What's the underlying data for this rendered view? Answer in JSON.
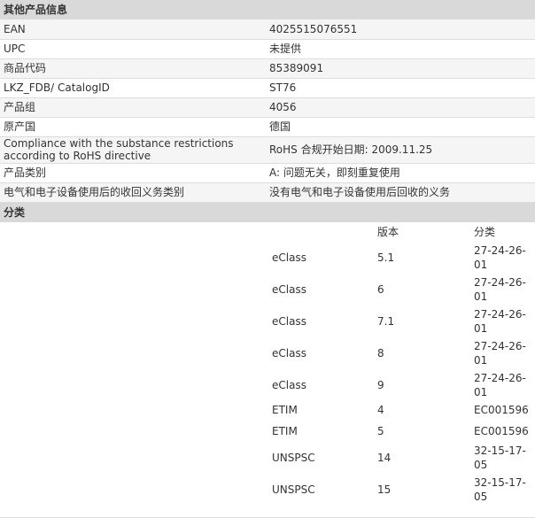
{
  "other_info": {
    "title": "其他产品信息",
    "rows": [
      {
        "label": "EAN",
        "value": "4025515076551"
      },
      {
        "label": "UPC",
        "value": "未提供"
      },
      {
        "label": "商品代码",
        "value": "85389091"
      },
      {
        "label": "LKZ_FDB/ CatalogID",
        "value": "ST76"
      },
      {
        "label": "产品组",
        "value": "4056"
      },
      {
        "label": "原产国",
        "value": "德国"
      },
      {
        "label": "Compliance with the substance restrictions according to RoHS directive",
        "value": "RoHS 合规开始日期: 2009.11.25"
      },
      {
        "label": "产品类别",
        "value": "A: 问题无关，即刻重复使用"
      },
      {
        "label": "电气和电子设备使用后的收回义务类别",
        "value": "没有电气和电子设备使用后回收的义务"
      }
    ]
  },
  "classification": {
    "title": "分类",
    "col_version": "版本",
    "col_class": "分类",
    "rows": [
      {
        "system": "eClass",
        "version": "5.1",
        "code": "27-24-26-01"
      },
      {
        "system": "eClass",
        "version": "6",
        "code": "27-24-26-01"
      },
      {
        "system": "eClass",
        "version": "7.1",
        "code": "27-24-26-01"
      },
      {
        "system": "eClass",
        "version": "8",
        "code": "27-24-26-01"
      },
      {
        "system": "eClass",
        "version": "9",
        "code": "27-24-26-01"
      },
      {
        "system": "ETIM",
        "version": "4",
        "code": "EC001596"
      },
      {
        "system": "ETIM",
        "version": "5",
        "code": "EC001596"
      },
      {
        "system": "UNSPSC",
        "version": "14",
        "code": "32-15-17-05"
      },
      {
        "system": "UNSPSC",
        "version": "15",
        "code": "32-15-17-05"
      }
    ]
  }
}
